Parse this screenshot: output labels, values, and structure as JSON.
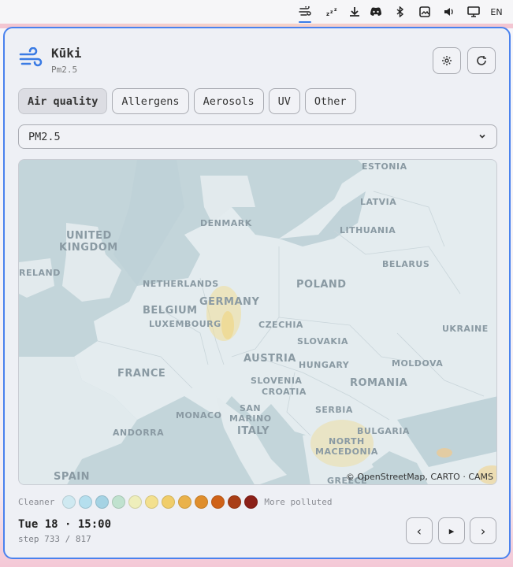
{
  "tray": {
    "lang": "EN",
    "icons": [
      "wind-icon",
      "sleep-icon",
      "download-icon",
      "discord-icon",
      "bluetooth-icon",
      "image-icon",
      "volume-icon",
      "monitor-icon"
    ]
  },
  "app": {
    "title": "Kūki",
    "subtitle": "Pm2.5"
  },
  "tabs": [
    {
      "label": "Air quality",
      "active": true
    },
    {
      "label": "Allergens",
      "active": false
    },
    {
      "label": "Aerosols",
      "active": false
    },
    {
      "label": "UV",
      "active": false
    },
    {
      "label": "Other",
      "active": false
    }
  ],
  "select": {
    "value": "PM2.5"
  },
  "map": {
    "labels": [
      "ESTONIA",
      "LATVIA",
      "DENMARK",
      "LITHUANIA",
      "UNITED",
      "KINGDOM",
      "RELAND",
      "BELARUS",
      "NETHERLANDS",
      "POLAND",
      "GERMANY",
      "BELGIUM",
      "LUXEMBOURG",
      "CZECHIA",
      "UKRAINE",
      "SLOVAKIA",
      "AUSTRIA",
      "HUNGARY",
      "MOLDOVA",
      "FRANCE",
      "SLOVENIA",
      "CROATIA",
      "ROMANIA",
      "SERBIA",
      "MONACO",
      "SAN",
      "MARINO",
      "ANDORRA",
      "ITALY",
      "BULGARIA",
      "NORTH",
      "MACEDONIA",
      "SPAIN",
      "GREECE"
    ],
    "attribution": "© OpenStreetMap, CARTO · CAMS"
  },
  "legend": {
    "left": "Cleaner",
    "right": "More polluted",
    "colors": [
      "#cfe9f1",
      "#b5dfee",
      "#a5d3e4",
      "#c0e2cf",
      "#eeeebb",
      "#f3e08e",
      "#f0cd6a",
      "#eab24a",
      "#df8e2c",
      "#cf6218",
      "#a93e16",
      "#8b2018"
    ]
  },
  "timeline": {
    "time": "Tue 18 · 15:00",
    "step": "step 733 / 817"
  },
  "controls": {
    "prev": "‹",
    "play": "▶",
    "next": "›"
  }
}
